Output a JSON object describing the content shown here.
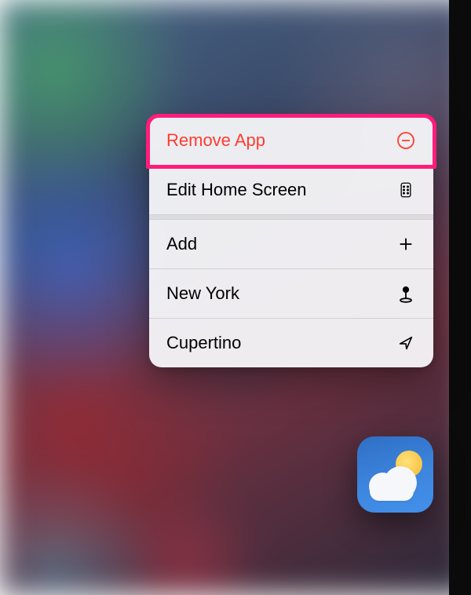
{
  "menu": {
    "items": [
      {
        "label": "Remove App",
        "icon": "minus-circle",
        "destructive": true
      },
      {
        "label": "Edit Home Screen",
        "icon": "homescreen",
        "destructive": false
      },
      {
        "label": "Add",
        "icon": "plus",
        "destructive": false
      },
      {
        "label": "New York",
        "icon": "pin",
        "destructive": false
      },
      {
        "label": "Cupertino",
        "icon": "location",
        "destructive": false
      }
    ]
  },
  "app": {
    "name": "Weather"
  },
  "colors": {
    "destructive": "#ff3b30",
    "highlight": "#ff1c7a"
  }
}
